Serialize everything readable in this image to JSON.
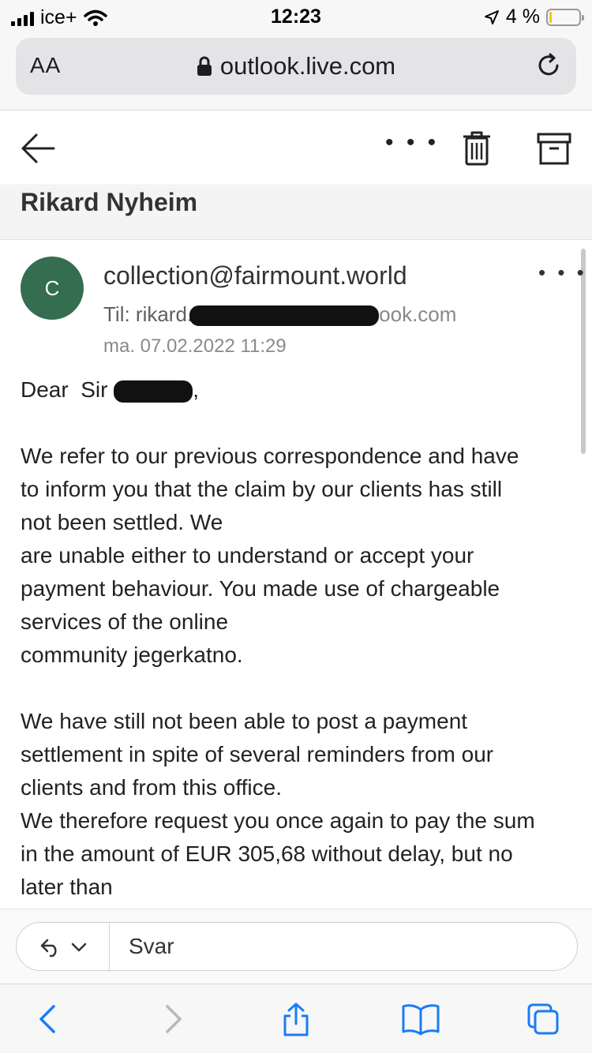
{
  "status_bar": {
    "carrier": "ice+",
    "time": "12:23",
    "battery": "4 %",
    "battery_level": 0.04
  },
  "safari": {
    "aa_label": "AA",
    "url": "outlook.live.com"
  },
  "mail_toolbar": {
    "more_label": "• • •"
  },
  "subject": "Rikard Nyheim",
  "message": {
    "avatar_initial": "C",
    "avatar_color": "#346d4f",
    "sender": "collection@fairmount.world",
    "to_prefix": "Til: rikard.",
    "to_tail": "ook.com",
    "date": "ma. 07.02.2022 11:29",
    "more_label": "• • •",
    "greeting_start": "Dear  Sir ",
    "greeting_end": ",",
    "paragraph_1_lines": [
      "We refer to our previous correspondence and have",
      "to inform you that the claim by our clients has still",
      "not been settled. We",
      "are unable either to understand or accept your",
      "payment behaviour. You made use of chargeable",
      "services of the online",
      "community jegerkatno."
    ],
    "paragraph_2_lines": [
      "We have still not been able to post a payment",
      "settlement in spite of several reminders from our",
      "clients and from this office.",
      "We therefore request you once again to pay the sum",
      "in the amount of EUR 305,68 without delay, but no",
      "later than"
    ]
  },
  "reply_bar": {
    "label": "Svar"
  },
  "colors": {
    "ios_blue": "#1a7cf5",
    "redaction": "#111111"
  }
}
